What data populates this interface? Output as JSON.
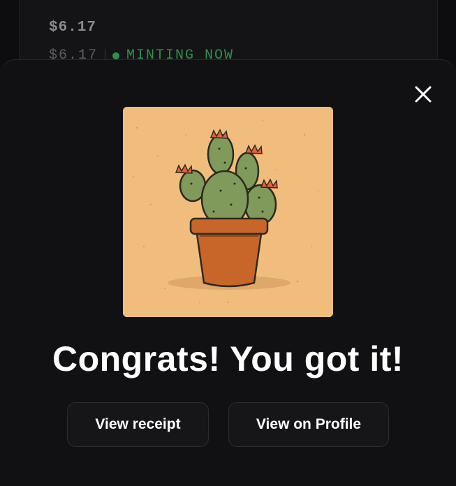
{
  "background": {
    "price": "$6.17",
    "price_repeat": "$6.17",
    "status": "MINTING NOW",
    "status_color": "#2f8f4e"
  },
  "modal": {
    "artwork_icon": "cactus-artwork",
    "headline": "Congrats! You got it!",
    "buttons": {
      "receipt": "View receipt",
      "profile": "View on Profile"
    },
    "close_icon": "close-icon"
  }
}
